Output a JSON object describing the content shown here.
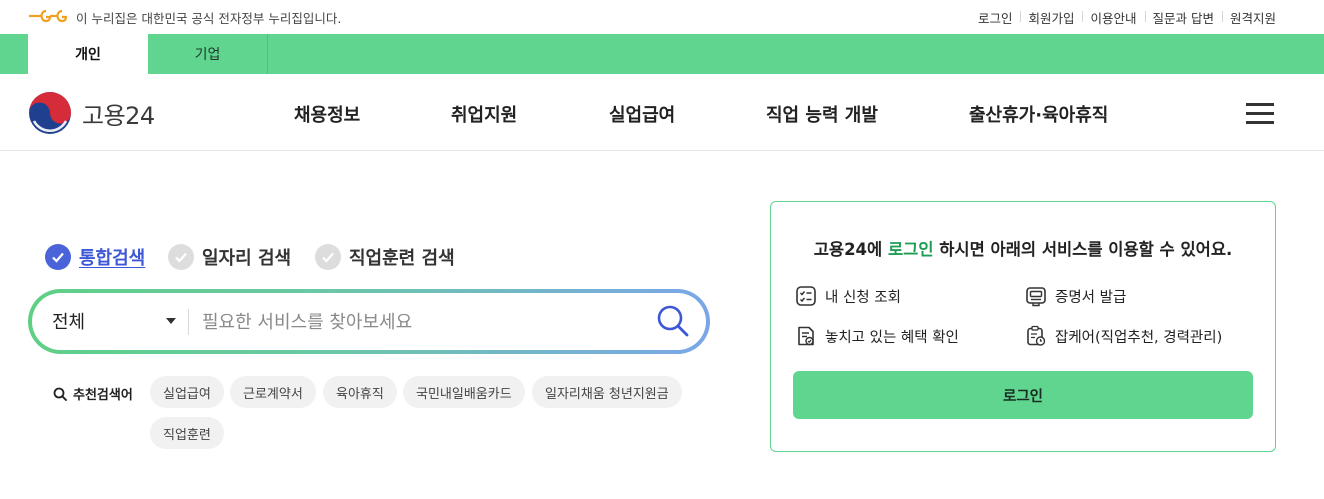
{
  "gov_banner": {
    "text": "이 누리집은 대한민국 공식 전자정부 누리집입니다.",
    "logo_icon": "eg-gov-logo-icon"
  },
  "util_links": [
    "로그인",
    "회원가입",
    "이용안내",
    "질문과 답변",
    "원격지원"
  ],
  "tabs": [
    {
      "label": "개인",
      "active": true
    },
    {
      "label": "기업",
      "active": false
    }
  ],
  "brand": {
    "name": "고용24",
    "emblem_icon": "taegeuk-emblem-icon"
  },
  "nav": [
    "채용정보",
    "취업지원",
    "실업급여",
    "직업 능력 개발",
    "출산휴가·육아휴직"
  ],
  "search": {
    "options": [
      {
        "label": "통합검색",
        "checked": true
      },
      {
        "label": "일자리 검색",
        "checked": false
      },
      {
        "label": "직업훈련 검색",
        "checked": false
      }
    ],
    "scope": "전체",
    "placeholder": "필요한 서비스를 찾아보세요",
    "recommend_label": "추천검색어",
    "keywords": [
      "실업급여",
      "근로계약서",
      "육아휴직",
      "국민내일배움카드",
      "일자리채움 청년지원금",
      "직업훈련"
    ]
  },
  "login_card": {
    "title_prefix": "고용24에 ",
    "title_highlight": "로그인",
    "title_suffix": " 하시면 아래의 서비스를 이용할 수 있어요.",
    "services": [
      "내 신청 조회",
      "증명서 발급",
      "놓치고 있는 혜택 확인",
      "잡케어(직업추천, 경력관리)"
    ],
    "button_label": "로그인"
  },
  "colors": {
    "brand_green": "#5fd58f",
    "accent_blue": "#3d57d6",
    "highlight_green": "#1e9e55"
  }
}
